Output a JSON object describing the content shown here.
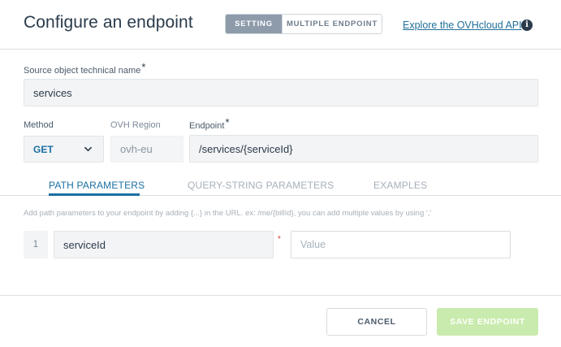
{
  "header": {
    "title": "Configure an endpoint",
    "modes": [
      "SETTING",
      "MULTIPLE ENDPOINT"
    ],
    "active_mode": "SETTING",
    "api_link": "Explore the OVHcloud API",
    "info_icon": "info-icon"
  },
  "source": {
    "label": "Source object technical name",
    "required_mark": "*",
    "value": "services"
  },
  "method": {
    "label": "Method",
    "value": "GET",
    "icon": "chevron-down-icon"
  },
  "region": {
    "label": "OVH Region",
    "value": "ovh-eu"
  },
  "endpoint": {
    "label": "Endpoint",
    "required_mark": "*",
    "value": "/services/{serviceId}"
  },
  "tabs": [
    {
      "label": "PATH PARAMETERS",
      "active": true
    },
    {
      "label": "QUERY-STRING PARAMETERS",
      "active": false
    },
    {
      "label": "EXAMPLES",
      "active": false
    }
  ],
  "path_params": {
    "hint": "Add path parameters to your endpoint by adding {...} in the URL. ex: /me/{billId}, you can add multiple values by using ','",
    "rows": [
      {
        "index": "1",
        "name": "serviceId",
        "required_mark": "*",
        "value_placeholder": "Value"
      }
    ]
  },
  "footer": {
    "cancel_label": "CANCEL",
    "save_label": "SAVE ENDPOINT"
  },
  "colors": {
    "accent": "#1a6fa3",
    "save_disabled": "#c9ebad",
    "required": "#d33c3c"
  }
}
